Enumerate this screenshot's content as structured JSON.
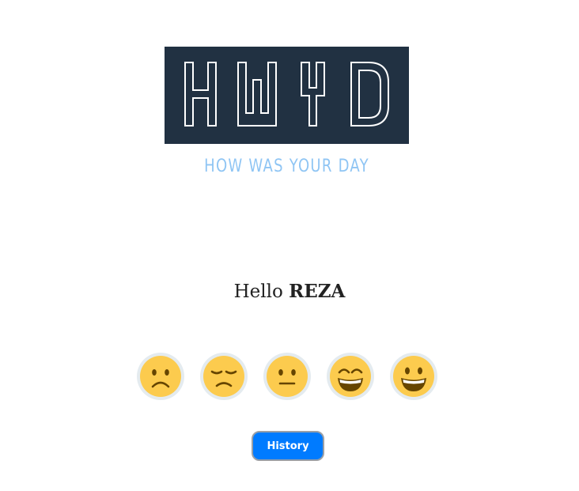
{
  "logo": {
    "text": "HWYD",
    "tagline": "HOW WAS YOUR DAY"
  },
  "greeting": {
    "prefix": "Hello ",
    "name": "REZA"
  },
  "moods": [
    {
      "icon": "slightly-frowning-face-icon"
    },
    {
      "icon": "unamused-face-icon"
    },
    {
      "icon": "neutral-face-icon"
    },
    {
      "icon": "grinning-squinting-face-icon"
    },
    {
      "icon": "grinning-face-icon"
    }
  ],
  "history_button": {
    "label": "History"
  },
  "colors": {
    "logo_background": "#213142",
    "tagline": "#8fc5f4",
    "emoji_face": "#fccb4e",
    "button": "#007bff"
  }
}
